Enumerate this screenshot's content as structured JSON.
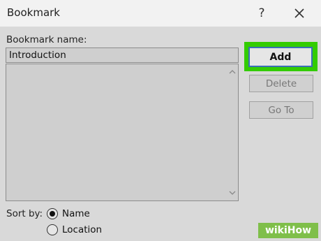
{
  "window": {
    "title": "Bookmark",
    "help_glyph": "?"
  },
  "name_field": {
    "label": "Bookmark name:",
    "value": "Introduction"
  },
  "buttons": {
    "add": "Add",
    "delete": "Delete",
    "goto": "Go To"
  },
  "sort": {
    "label": "Sort by:",
    "options": [
      "Name",
      "Location"
    ],
    "selected": "Name"
  },
  "colors": {
    "highlight": "#33cc00",
    "focus_border": "#3a6fb5",
    "watermark_bg": "#7fbf4a"
  },
  "watermark": "wikiHow",
  "icons": {
    "help": "question-mark-icon",
    "close": "close-x-icon",
    "scroll_up": "chevron-up-icon",
    "scroll_down": "chevron-down-icon"
  }
}
